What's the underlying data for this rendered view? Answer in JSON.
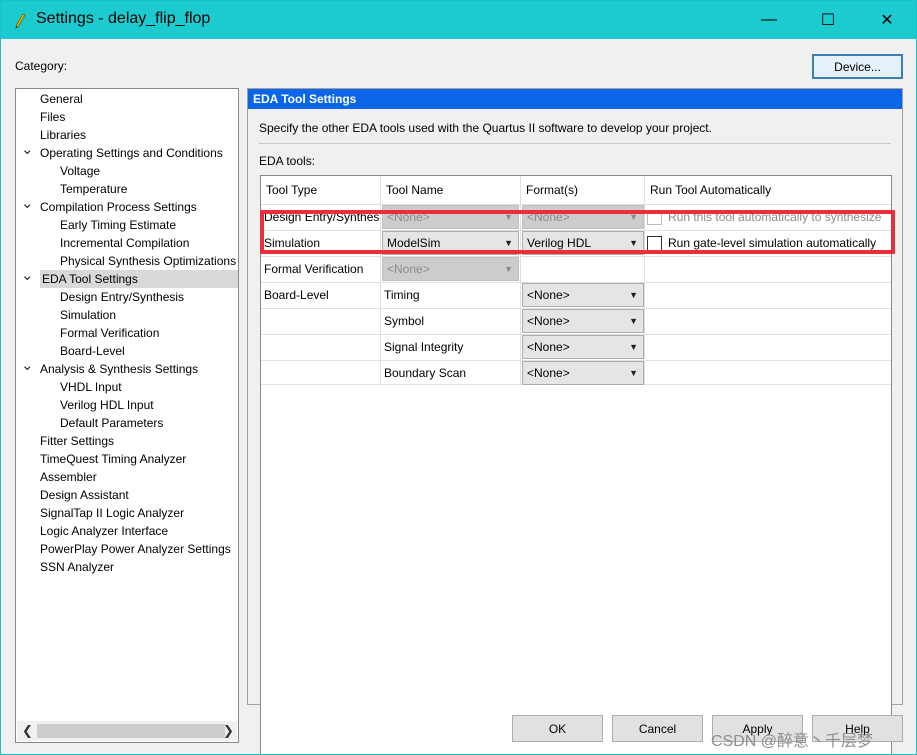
{
  "window": {
    "title": "Settings - delay_flip_flop",
    "minimize_glyph": "—",
    "maximize_glyph": "☐",
    "close_glyph": "✕",
    "titlebar_color": "#1ccbcf"
  },
  "category_label": "Category:",
  "device_button": "Device...",
  "tree": {
    "items": [
      {
        "label": "General",
        "level": 1,
        "expander": ""
      },
      {
        "label": "Files",
        "level": 1,
        "expander": ""
      },
      {
        "label": "Libraries",
        "level": 1,
        "expander": ""
      },
      {
        "label": "Operating Settings and Conditions",
        "level": 1,
        "expander": "expanded"
      },
      {
        "label": "Voltage",
        "level": 2,
        "expander": ""
      },
      {
        "label": "Temperature",
        "level": 2,
        "expander": ""
      },
      {
        "label": "Compilation Process Settings",
        "level": 1,
        "expander": "expanded"
      },
      {
        "label": "Early Timing Estimate",
        "level": 2,
        "expander": ""
      },
      {
        "label": "Incremental Compilation",
        "level": 2,
        "expander": ""
      },
      {
        "label": "Physical Synthesis Optimizations",
        "level": 2,
        "expander": ""
      },
      {
        "label": "EDA Tool Settings",
        "level": 1,
        "expander": "expanded",
        "selected": true
      },
      {
        "label": "Design Entry/Synthesis",
        "level": 2,
        "expander": ""
      },
      {
        "label": "Simulation",
        "level": 2,
        "expander": ""
      },
      {
        "label": "Formal Verification",
        "level": 2,
        "expander": ""
      },
      {
        "label": "Board-Level",
        "level": 2,
        "expander": ""
      },
      {
        "label": "Analysis & Synthesis Settings",
        "level": 1,
        "expander": "expanded"
      },
      {
        "label": "VHDL Input",
        "level": 2,
        "expander": ""
      },
      {
        "label": "Verilog HDL Input",
        "level": 2,
        "expander": ""
      },
      {
        "label": "Default Parameters",
        "level": 2,
        "expander": ""
      },
      {
        "label": "Fitter Settings",
        "level": 1,
        "expander": ""
      },
      {
        "label": "TimeQuest Timing Analyzer",
        "level": 1,
        "expander": ""
      },
      {
        "label": "Assembler",
        "level": 1,
        "expander": ""
      },
      {
        "label": "Design Assistant",
        "level": 1,
        "expander": ""
      },
      {
        "label": "SignalTap II Logic Analyzer",
        "level": 1,
        "expander": ""
      },
      {
        "label": "Logic Analyzer Interface",
        "level": 1,
        "expander": ""
      },
      {
        "label": "PowerPlay Power Analyzer Settings",
        "level": 1,
        "expander": ""
      },
      {
        "label": "SSN Analyzer",
        "level": 1,
        "expander": ""
      }
    ]
  },
  "panel": {
    "header": "EDA Tool Settings",
    "description": "Specify the other EDA tools used with the Quartus II software to develop your project.",
    "eda_tools_label": "EDA tools:",
    "header_color": "#0a66e8"
  },
  "table": {
    "columns": [
      "Tool Type",
      "Tool Name",
      "Format(s)",
      "Run Tool Automatically"
    ],
    "rows": [
      {
        "type": "Design Entry/Synthesis",
        "name": "<None>",
        "format": "<None>",
        "run": "Run this tool automatically to synthesize",
        "state": "disabled"
      },
      {
        "type": "Simulation",
        "name": "ModelSim",
        "format": "Verilog HDL",
        "run": "Run gate-level simulation automatically",
        "state": "enabled"
      },
      {
        "type": "Formal Verification",
        "name": "<None>",
        "format": "",
        "run": "",
        "state": "name-disabled"
      },
      {
        "type": "Board-Level",
        "name": "Timing",
        "format": "<None>",
        "run": "",
        "state": "board"
      },
      {
        "type": "",
        "name": "Symbol",
        "format": "<None>",
        "run": "",
        "state": "board"
      },
      {
        "type": "",
        "name": "Signal Integrity",
        "format": "<None>",
        "run": "",
        "state": "board"
      },
      {
        "type": "",
        "name": "Boundary Scan",
        "format": "<None>",
        "run": "",
        "state": "board"
      }
    ],
    "highlight_color": "#ec2d3b"
  },
  "buttons": {
    "ok": "OK",
    "cancel": "Cancel",
    "apply": "Apply",
    "help": "Help"
  },
  "watermark": "CSDN @醉意丶千层梦"
}
